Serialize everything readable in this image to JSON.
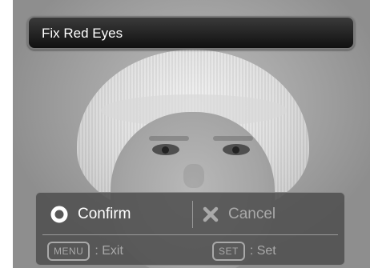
{
  "title_bar": {
    "title": "Fix Red Eyes"
  },
  "menu": {
    "options": [
      {
        "label": "Confirm",
        "icon": "circle-icon",
        "state": "selected"
      },
      {
        "label": "Cancel",
        "icon": "x-icon",
        "state": "unselected"
      }
    ],
    "key_hints": [
      {
        "key": "MENU",
        "action": ": Exit"
      },
      {
        "key": "SET",
        "action": ": Set"
      }
    ]
  },
  "colors": {
    "selected_text": "#ffffff",
    "inactive_text": "#a9a9a9",
    "panel_bg": "#505050",
    "title_bg": "#101010"
  }
}
